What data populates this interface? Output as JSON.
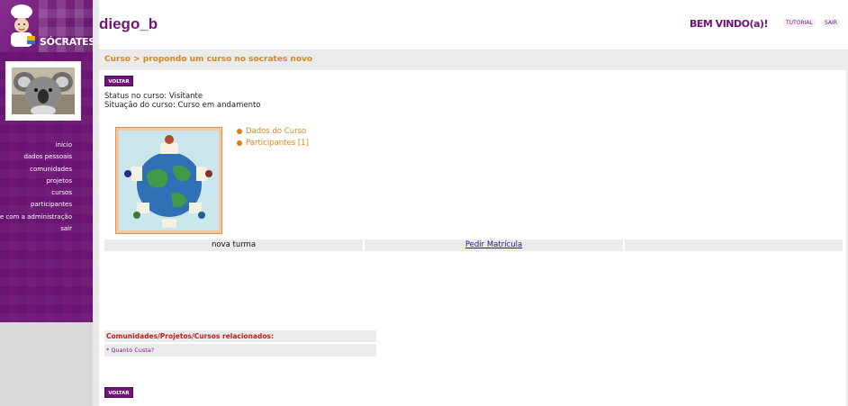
{
  "logo": {
    "text": "SÓCRATES"
  },
  "sidebar": {
    "nav": [
      {
        "label": "inicio"
      },
      {
        "label": "dados pessoais"
      },
      {
        "label": "comunidades"
      },
      {
        "label": "projetos"
      },
      {
        "label": "cursos"
      },
      {
        "label": "participantes"
      },
      {
        "label": "fale com a administração"
      },
      {
        "label": "sair"
      }
    ]
  },
  "header": {
    "username": "diego_b",
    "welcome": "BEM VINDO(a)!",
    "tutorial_label": "TUTORIAL",
    "sair_label": "SAIR"
  },
  "main": {
    "breadcrumb": "Curso > propondo um curso no socrates novo",
    "voltar_label": "VOLTAR",
    "status_line": "Status no curso: Visitante",
    "situacao_line": "Situação do curso: Curso em andamento",
    "links": {
      "dados": "Dados do Curso",
      "participantes": "Participantes [1]"
    },
    "turma": {
      "name": "nova turma",
      "action": "Pedir Matrícula"
    },
    "related": {
      "header": "Comunidades/Projetos/Cursos relacionados:",
      "item": "* Quanto Custa?"
    }
  },
  "colors": {
    "brand_purple": "#6e1577",
    "accent_orange": "#d4891b",
    "related_red": "#c0201a"
  }
}
